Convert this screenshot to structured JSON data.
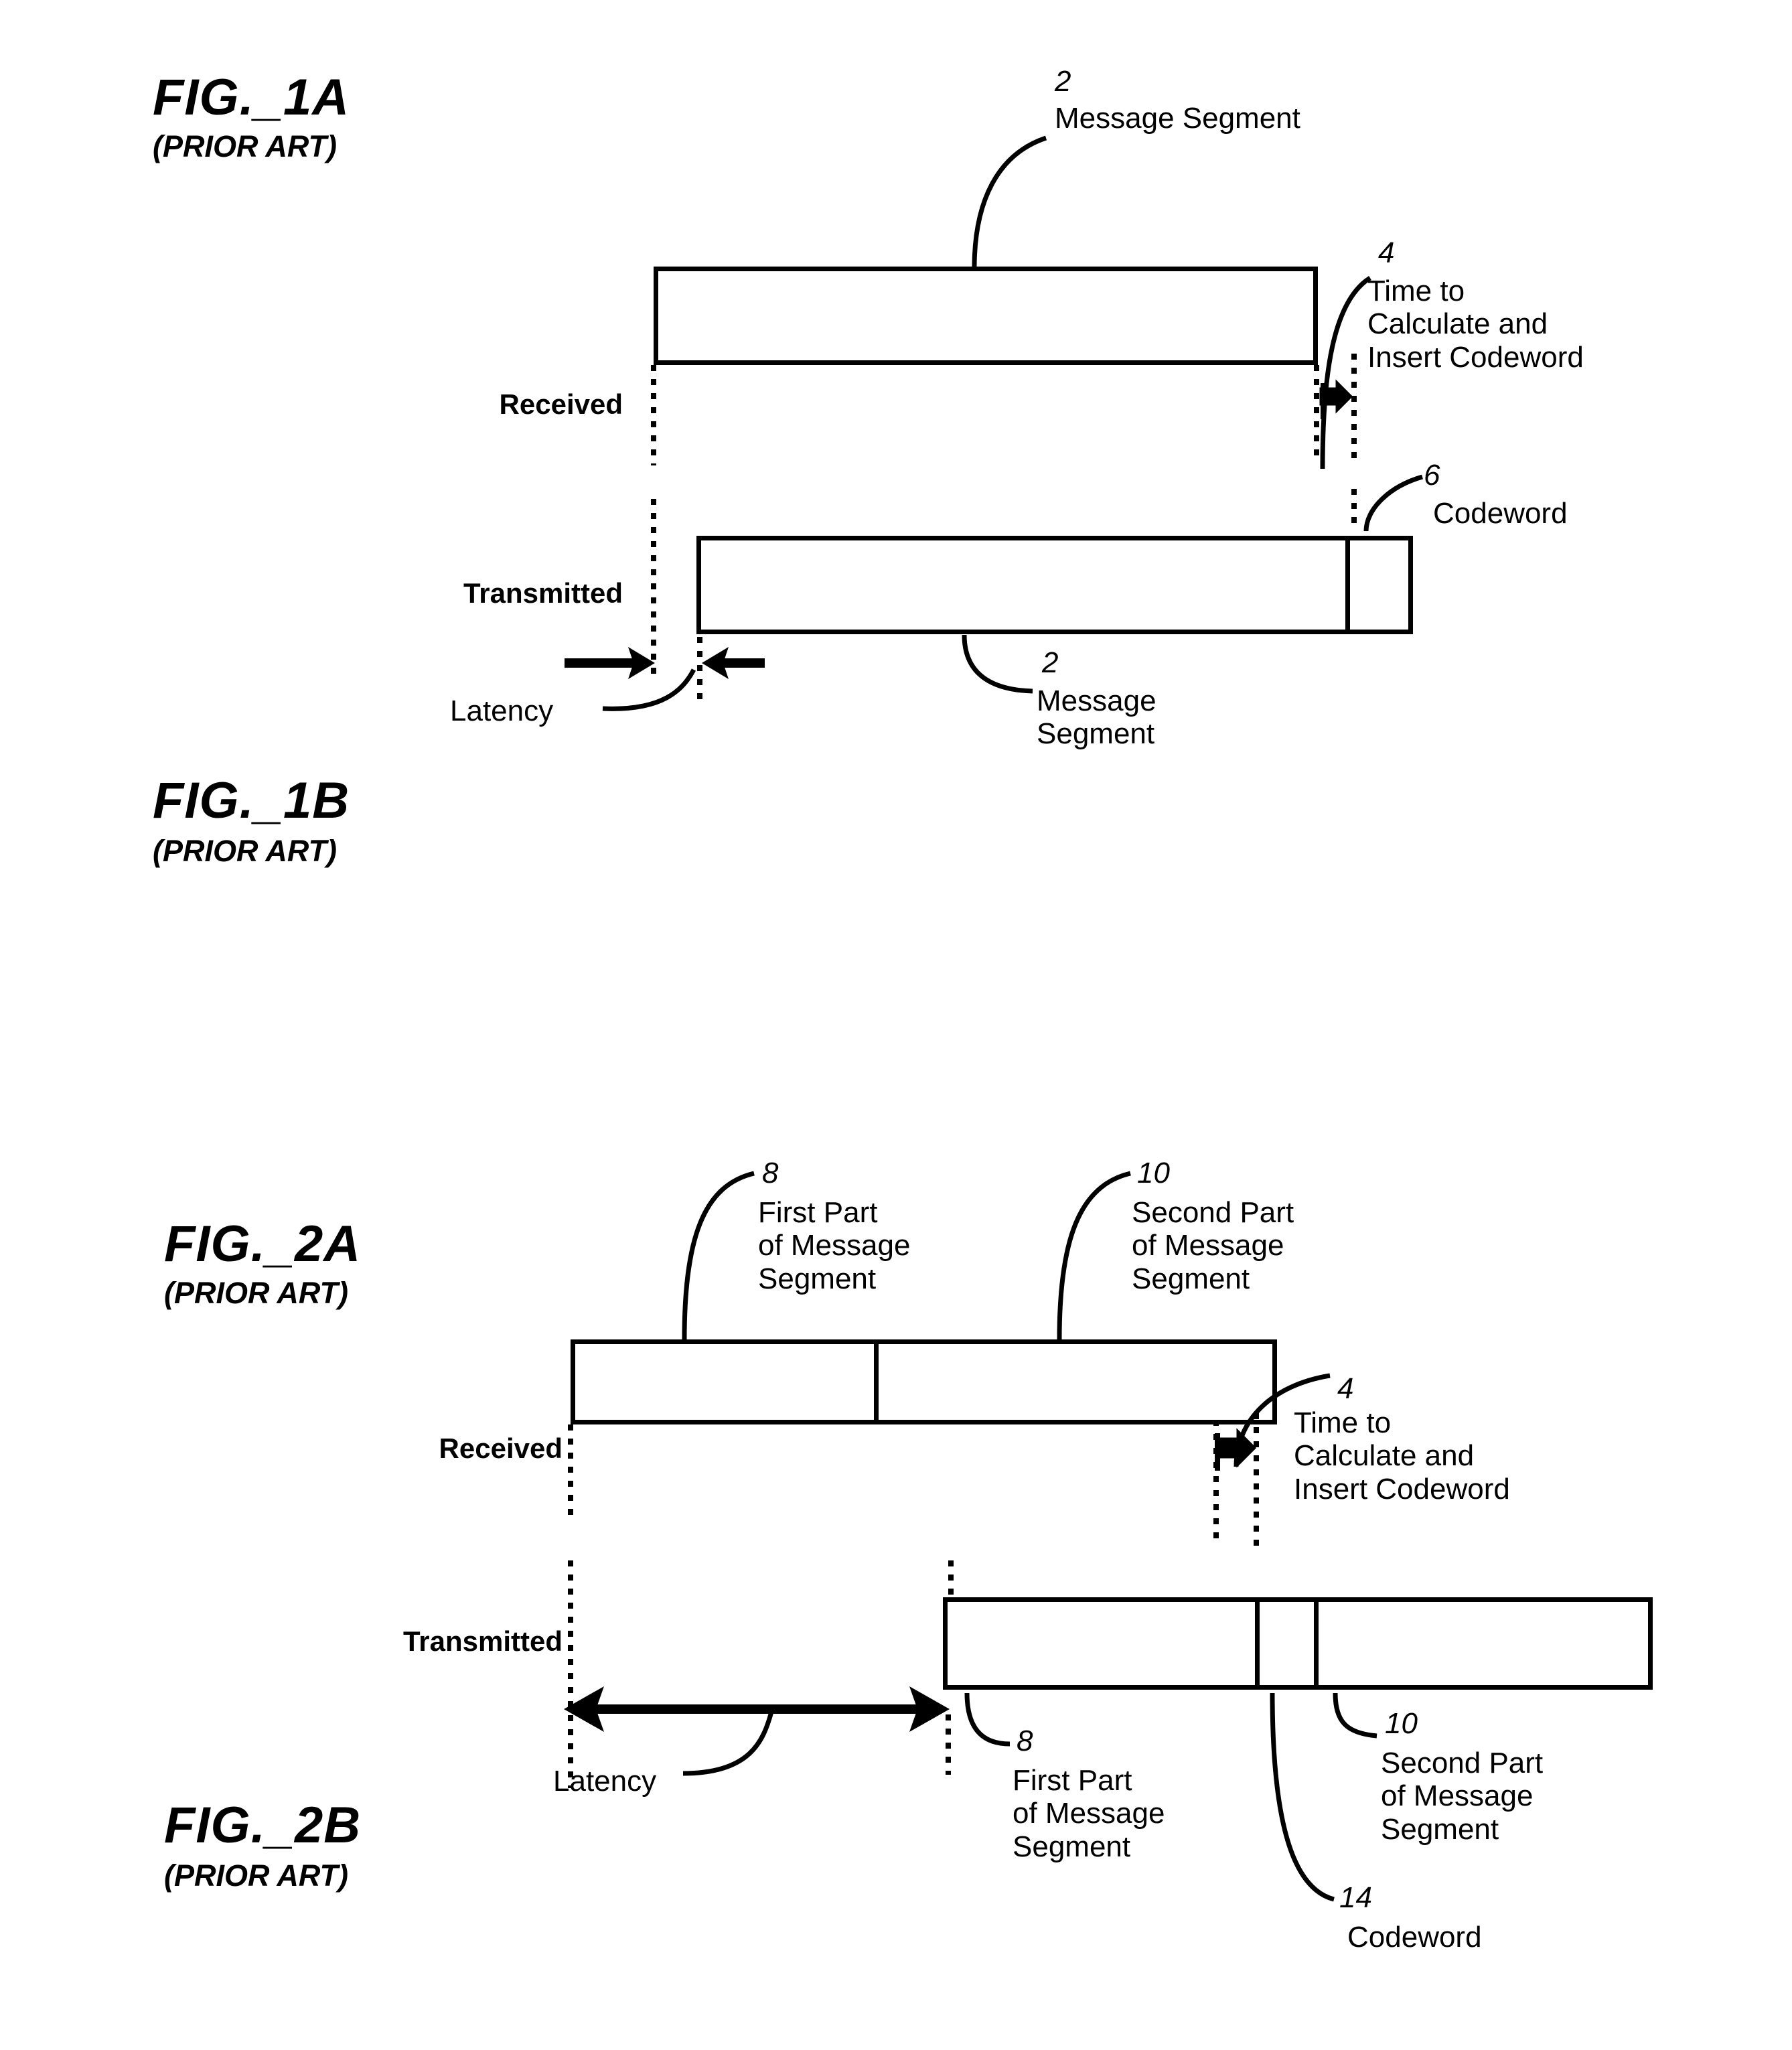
{
  "document": {
    "type": "patent-figure-sheet",
    "figures": [
      {
        "id": "fig1a",
        "label": "FIG._1A",
        "sublabel": "(PRIOR ART)",
        "rows": [
          {
            "name": "received",
            "label": "Received"
          },
          {
            "name": "transmitted",
            "label": "Transmitted"
          }
        ],
        "callouts": [
          {
            "number": "2",
            "text": "Message Segment",
            "target": "received-message-segment"
          },
          {
            "number": "4",
            "text": "Time to\nCalculate and\nInsert Codeword",
            "target": "calc-insert-gap"
          },
          {
            "number": "6",
            "text": "Codeword",
            "target": "transmitted-codeword"
          },
          {
            "number": "2",
            "text": "Message\nSegment",
            "target": "transmitted-message-segment"
          }
        ],
        "annotations": [
          {
            "name": "latency",
            "text": "Latency"
          }
        ]
      },
      {
        "id": "fig1b",
        "label": "FIG._1B",
        "sublabel": "(PRIOR ART)"
      },
      {
        "id": "fig2a",
        "label": "FIG._2A",
        "sublabel": "(PRIOR ART)",
        "rows": [
          {
            "name": "received",
            "label": "Received"
          },
          {
            "name": "transmitted",
            "label": "Transmitted"
          }
        ],
        "callouts": [
          {
            "number": "8",
            "text": "First Part\nof Message\nSegment",
            "target": "received-first-part"
          },
          {
            "number": "10",
            "text": "Second Part\nof Message\nSegment",
            "target": "received-second-part"
          },
          {
            "number": "4",
            "text": "Time to\nCalculate and\nInsert Codeword",
            "target": "calc-insert-gap"
          },
          {
            "number": "8",
            "text": "First Part\nof Message\nSegment",
            "target": "transmitted-first-part"
          },
          {
            "number": "10",
            "text": "Second Part\nof Message\nSegment",
            "target": "transmitted-second-part"
          },
          {
            "number": "14",
            "text": "Codeword",
            "target": "transmitted-codeword"
          }
        ],
        "annotations": [
          {
            "name": "latency",
            "text": "Latency"
          }
        ]
      },
      {
        "id": "fig2b",
        "label": "FIG._2B",
        "sublabel": "(PRIOR ART)"
      }
    ]
  },
  "fig1a": {
    "label": "FIG._1A",
    "sublabel": "(PRIOR ART)",
    "received_label": "Received",
    "transmitted_label": "Transmitted",
    "callout_2_num": "2",
    "callout_2_text": "Message Segment",
    "callout_4_num": "4",
    "callout_4_line1": "Time to",
    "callout_4_line2": "Calculate and",
    "callout_4_line3": "Insert Codeword",
    "callout_6_num": "6",
    "callout_6_text": "Codeword",
    "callout_2b_num": "2",
    "callout_2b_line1": "Message",
    "callout_2b_line2": "Segment",
    "latency_label": "Latency"
  },
  "fig1b": {
    "label": "FIG._1B",
    "sublabel": "(PRIOR ART)"
  },
  "fig2a": {
    "label": "FIG._2A",
    "sublabel": "(PRIOR ART)",
    "received_label": "Received",
    "transmitted_label": "Transmitted",
    "callout_8_num": "8",
    "callout_8_line1": "First Part",
    "callout_8_line2": "of Message",
    "callout_8_line3": "Segment",
    "callout_10_num": "10",
    "callout_10_line1": "Second Part",
    "callout_10_line2": "of Message",
    "callout_10_line3": "Segment",
    "callout_4_num": "4",
    "callout_4_line1": "Time to",
    "callout_4_line2": "Calculate and",
    "callout_4_line3": "Insert Codeword",
    "latency_label": "Latency",
    "callout_8b_num": "8",
    "callout_8b_line1": "First Part",
    "callout_8b_line2": "of Message",
    "callout_8b_line3": "Segment",
    "callout_10b_num": "10",
    "callout_10b_line1": "Second Part",
    "callout_10b_line2": "of Message",
    "callout_10b_line3": "Segment",
    "callout_14_num": "14",
    "callout_14_text": "Codeword"
  },
  "fig2b": {
    "label": "FIG._2B",
    "sublabel": "(PRIOR ART)"
  },
  "colors": {
    "ink": "#000000",
    "paper": "#ffffff"
  }
}
